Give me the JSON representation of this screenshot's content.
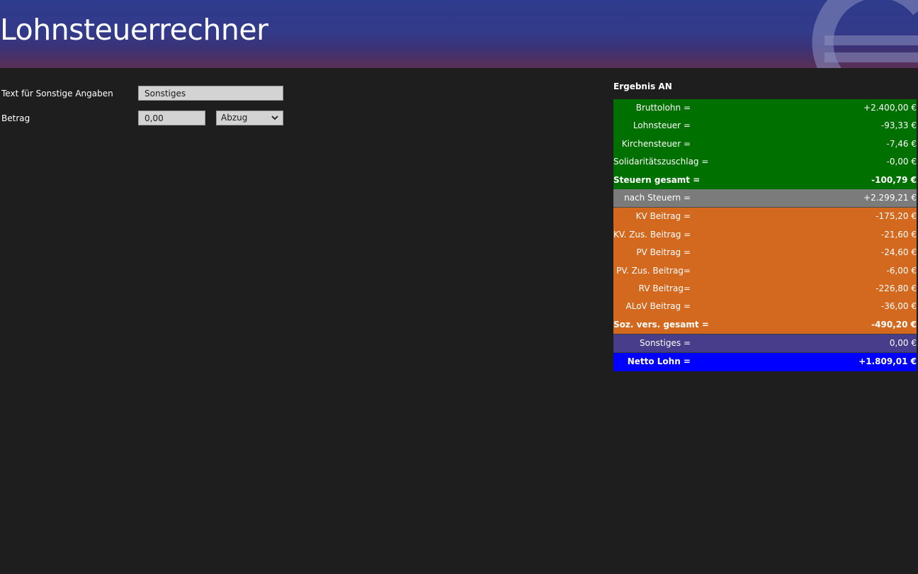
{
  "app": {
    "title": "Lohnsteuerrechner"
  },
  "form": {
    "text_label": "Text für Sonstige Angaben",
    "text_value": "Sonstiges",
    "amount_label": "Betrag",
    "amount_value": "0,00",
    "type_select": "Abzug"
  },
  "results": {
    "heading": "Ergebnis AN",
    "rows": [
      {
        "label": "Bruttolohn =",
        "value": "+2.400,00 €"
      },
      {
        "label": "Lohnsteuer =",
        "value": "-93,33 €"
      },
      {
        "label": "Kirchensteuer =",
        "value": "-7,46 €"
      },
      {
        "label": "Solidaritätszuschlag =",
        "value": "-0,00 €"
      },
      {
        "label": "Steuern gesamt =",
        "value": "-100,79 €"
      },
      {
        "label": "nach Steuern =",
        "value": "+2.299,21 €"
      },
      {
        "label": "KV Beitrag =",
        "value": "-175,20 €"
      },
      {
        "label": "KV. Zus. Beitrag =",
        "value": "-21,60 €"
      },
      {
        "label": "PV Beitrag =",
        "value": "-24,60 €"
      },
      {
        "label": "PV. Zus. Beitrag=",
        "value": "-6,00 €"
      },
      {
        "label": "RV Beitrag=",
        "value": "-226,80 €"
      },
      {
        "label": "ALoV Beitrag =",
        "value": "-36,00 €"
      },
      {
        "label": "Soz. vers. gesamt =",
        "value": "-490,20 €"
      },
      {
        "label": "Sonstiges =",
        "value": "0,00 €"
      },
      {
        "label": "Netto Lohn =",
        "value": "+1.809,01 €"
      }
    ]
  },
  "colors": {
    "taxes": "#007000",
    "after_taxes": "#7b7b7b",
    "social": "#d2691e",
    "other": "#483d8b",
    "net": "#0000ff"
  }
}
